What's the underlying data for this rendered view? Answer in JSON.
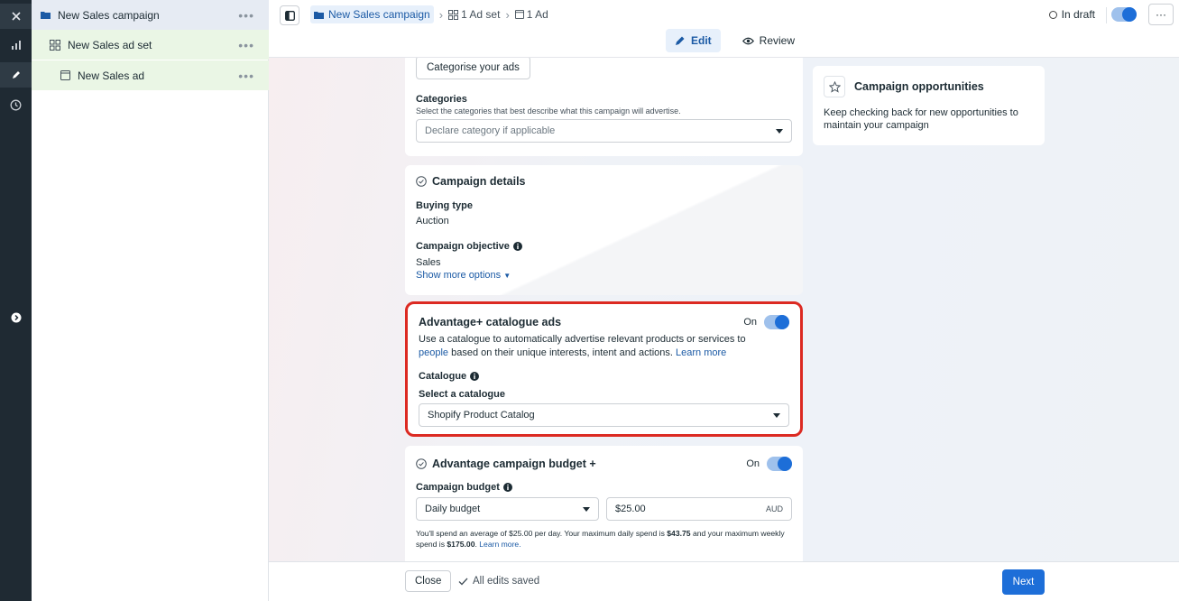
{
  "rail": {
    "icons": [
      "close-icon",
      "chart-icon",
      "pencil-icon",
      "clock-icon",
      "expand-icon"
    ]
  },
  "tree": {
    "campaign": "New Sales campaign",
    "adset": "New Sales ad set",
    "ad": "New Sales ad",
    "more": "•••"
  },
  "topbar": {
    "breadcrumb": {
      "campaign": "New Sales campaign",
      "adset": "1 Ad set",
      "ad": "1 Ad"
    },
    "status": "In draft",
    "more": "···",
    "modes": {
      "edit": "Edit",
      "review": "Review"
    }
  },
  "categories_card": {
    "button": "Categorise your ads",
    "label": "Categories",
    "help": "Select the categories that best describe what this campaign will advertise.",
    "placeholder": "Declare category if applicable"
  },
  "details_card": {
    "title": "Campaign details",
    "buying_type_label": "Buying type",
    "buying_type": "Auction",
    "objective_label": "Campaign objective",
    "objective": "Sales",
    "show_more": "Show more options"
  },
  "catalogue_card": {
    "title": "Advantage+ catalogue ads",
    "on": "On",
    "desc_1": "Use a catalogue to automatically advertise relevant products or services to",
    "desc_link": "people",
    "desc_2": " based on their unique interests, intent and actions. ",
    "learn_more": "Learn more",
    "catalogue_label": "Catalogue",
    "select_label": "Select a catalogue",
    "selected": "Shopify Product Catalog"
  },
  "budget_card": {
    "title": "Advantage campaign budget +",
    "on": "On",
    "budget_label": "Campaign budget",
    "budget_type": "Daily budget",
    "amount": "$25.00",
    "currency": "AUD",
    "note_1": "You'll spend an average of $25.00 per day. Your maximum daily spend is ",
    "note_max_daily": "$43.75",
    "note_2": " and your maximum weekly spend is ",
    "note_max_weekly": "$175.00",
    "note_3": ". ",
    "learn_more": "Learn more."
  },
  "opportunities": {
    "title": "Campaign opportunities",
    "text": "Keep checking back for new opportunities to maintain your campaign"
  },
  "bottombar": {
    "close": "Close",
    "saved": "All edits saved",
    "next": "Next"
  }
}
